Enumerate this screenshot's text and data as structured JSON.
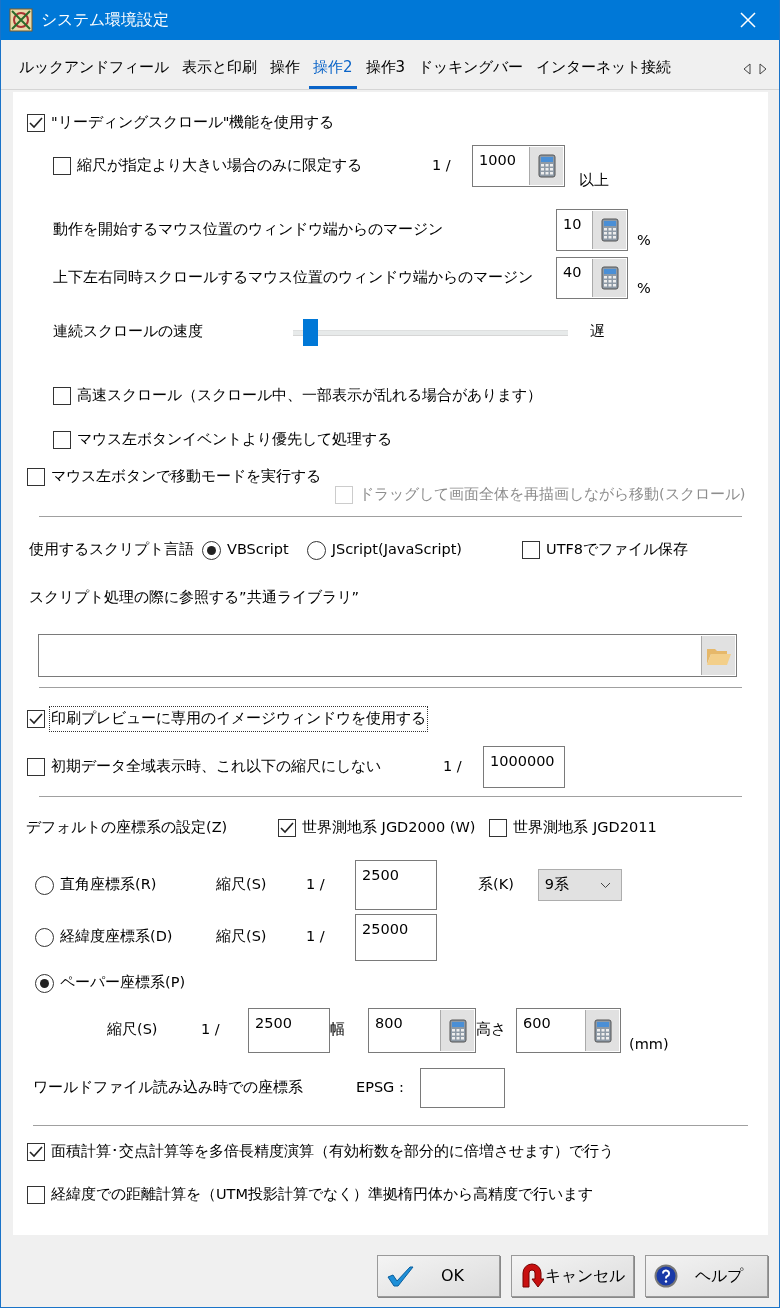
{
  "window": {
    "title": "システム環境設定"
  },
  "tabs": [
    {
      "label": "ルックアンドフィール",
      "selected": false
    },
    {
      "label": "表示と印刷",
      "selected": false
    },
    {
      "label": "操作",
      "selected": false
    },
    {
      "label": "操作2",
      "selected": true
    },
    {
      "label": "操作3",
      "selected": false
    },
    {
      "label": "ドッキングバー",
      "selected": false
    },
    {
      "label": "インターネット接続",
      "selected": false
    }
  ],
  "reading_scroll": {
    "label": "\"リーディングスクロール\"機能を使用する",
    "checked": true,
    "limit": {
      "label": "縮尺が指定より大きい場合のみに限定する",
      "checked": false,
      "prefix": "1 /",
      "value": "1000",
      "suffix": "以上"
    },
    "margins": [
      {
        "label": "動作を開始するマウス位置のウィンドウ端からのマージン",
        "value": "10",
        "unit": "%"
      },
      {
        "label": "上下左右同時スクロールするマウス位置のウィンドウ端からのマージン",
        "value": "40",
        "unit": "%"
      }
    ],
    "speed": {
      "label": "連続スクロールの速度",
      "level": 0.04,
      "suffix": "遅"
    },
    "options": [
      {
        "label": "高速スクロール（スクロール中、一部表示が乱れる場合があります）",
        "checked": false
      },
      {
        "label": "マウス左ボタンイベントより優先して処理する",
        "checked": false
      }
    ]
  },
  "move_mode": {
    "label": "マウス左ボタンで移動モードを実行する",
    "checked": false,
    "drag": {
      "label": "ドラッグして画面全体を再描画しながら移動(スクロール)",
      "checked": false,
      "disabled": true
    }
  },
  "script": {
    "label": "使用するスクリプト言語",
    "languages": [
      {
        "label": "VBScript",
        "selected": true
      },
      {
        "label": "JScript(JavaScript)",
        "selected": false
      }
    ],
    "utf8": {
      "label": "UTF8でファイル保存",
      "checked": false
    },
    "library_label": "スクリプト処理の際に参照する”共通ライブラリ”"
  },
  "print_preview": {
    "label": "印刷プレビューに専用のイメージウィンドウを使用する",
    "checked": true,
    "focused": true
  },
  "initial_scale": {
    "label": "初期データ全域表示時、これ以下の縮尺にしない",
    "checked": false,
    "prefix": "1 /",
    "value": "1000000"
  },
  "coords": {
    "label": "デフォルトの座標系の設定(Z)",
    "datums": [
      {
        "label": "世界測地系 JGD2000 (W)",
        "checked": true
      },
      {
        "label": "世界測地系 JGD2011",
        "checked": false
      }
    ],
    "systems": [
      {
        "kind": "zone",
        "label": "直角座標系(R)",
        "selected": false,
        "scale_label": "縮尺(S)",
        "prefix": "1 /",
        "value": "2500",
        "zone_label": "系(K)",
        "zone_value": "9系"
      },
      {
        "kind": "plain",
        "label": "経緯度座標系(D)",
        "selected": false,
        "scale_label": "縮尺(S)",
        "prefix": "1 /",
        "value": "25000"
      },
      {
        "kind": "paper",
        "label": "ペーパー座標系(P)",
        "selected": true,
        "scale_label": "縮尺(S)",
        "prefix": "1 /",
        "value": "2500",
        "width_label": "幅",
        "width_value": "800",
        "height_label": "高さ",
        "height_value": "600",
        "unit": "(mm)"
      }
    ]
  },
  "world_file": {
    "label": "ワールドファイル読み込み時での座標系",
    "epsg_label": "EPSG :"
  },
  "precision": [
    {
      "label": "面積計算･交点計算等を多倍長精度演算（有効桁数を部分的に倍増させます）で行う",
      "checked": true
    },
    {
      "label": "経緯度での距離計算を（UTM投影計算でなく）準拠楕円体から高精度で行います",
      "checked": false
    }
  ],
  "buttons": [
    {
      "kind": "ok",
      "label": "OK"
    },
    {
      "kind": "cancel",
      "label": "キャンセル"
    },
    {
      "kind": "help",
      "label": "ヘルプ"
    }
  ]
}
